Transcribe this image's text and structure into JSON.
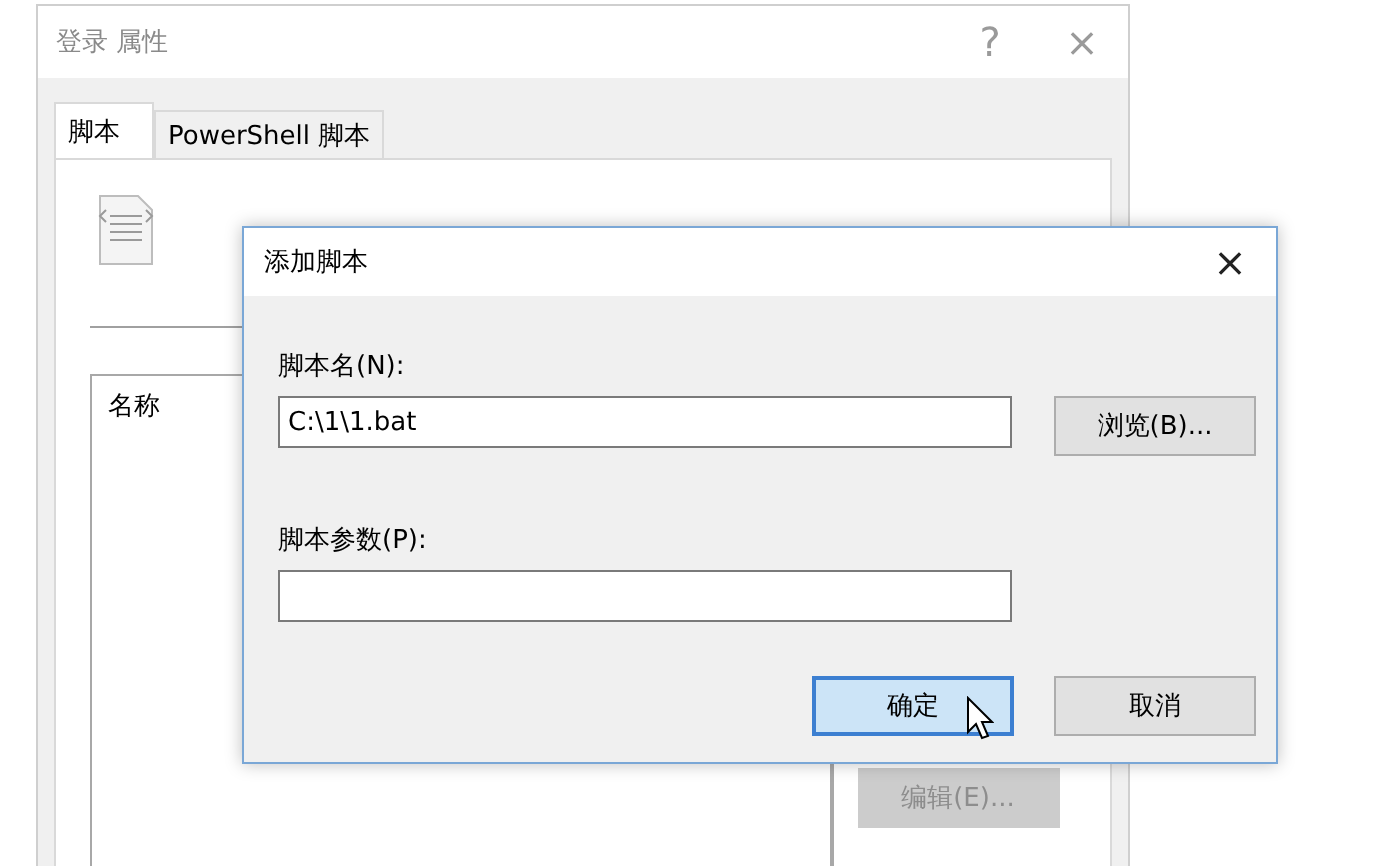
{
  "main_window": {
    "title": "登录 属性",
    "help": "?",
    "close": "×",
    "tabs": [
      {
        "label": "脚本",
        "selected": true
      },
      {
        "label": "PowerShell 脚本",
        "selected": false
      }
    ],
    "list_header": "名称",
    "side_buttons": [
      {
        "label": "编辑(E)...",
        "disabled": true
      }
    ]
  },
  "dialog": {
    "title": "添加脚本",
    "close": "×",
    "fields": [
      {
        "label": "脚本名(N):",
        "value": "C:\\1\\1.bat",
        "button": "浏览(B)..."
      },
      {
        "label": "脚本参数(P):"
      }
    ],
    "buttons": [
      {
        "label": "确定",
        "default": true
      },
      {
        "label": "取消",
        "default": false
      }
    ]
  }
}
